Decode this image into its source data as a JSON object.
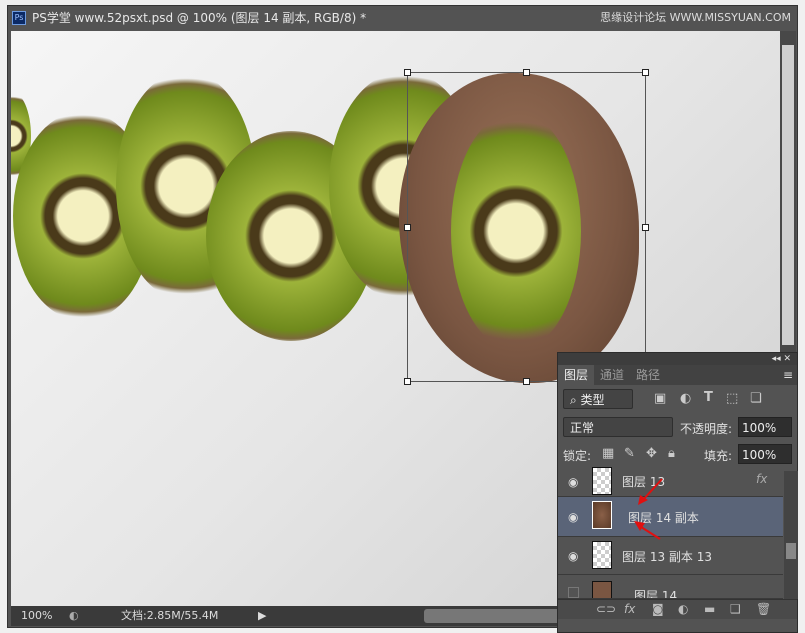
{
  "window": {
    "app_icon": "Ps",
    "title": "PS学堂 www.52psxt.psd @ 100% (图层 14 副本, RGB/8) *",
    "watermark": "思缘设计论坛 WWW.MISSYUAN.COM"
  },
  "status": {
    "zoom": "100%",
    "doc": "文档:2.85M/55.4M"
  },
  "panel": {
    "tabs": [
      "图层",
      "通道",
      "路径"
    ],
    "filter": "类型",
    "blend_mode": "正常",
    "opacity_label": "不透明度:",
    "opacity": "100%",
    "lock_label": "锁定:",
    "fill_label": "填充:",
    "fill": "100%",
    "layers": [
      {
        "name": "图层 13",
        "visible": true,
        "fx": "fx"
      },
      {
        "name": "图层 14 副本",
        "visible": true,
        "selected": true
      },
      {
        "name": "图层 13 副本 13",
        "visible": true
      },
      {
        "name": "图层 14",
        "visible": false
      }
    ],
    "selected_color": "#5a6478"
  }
}
